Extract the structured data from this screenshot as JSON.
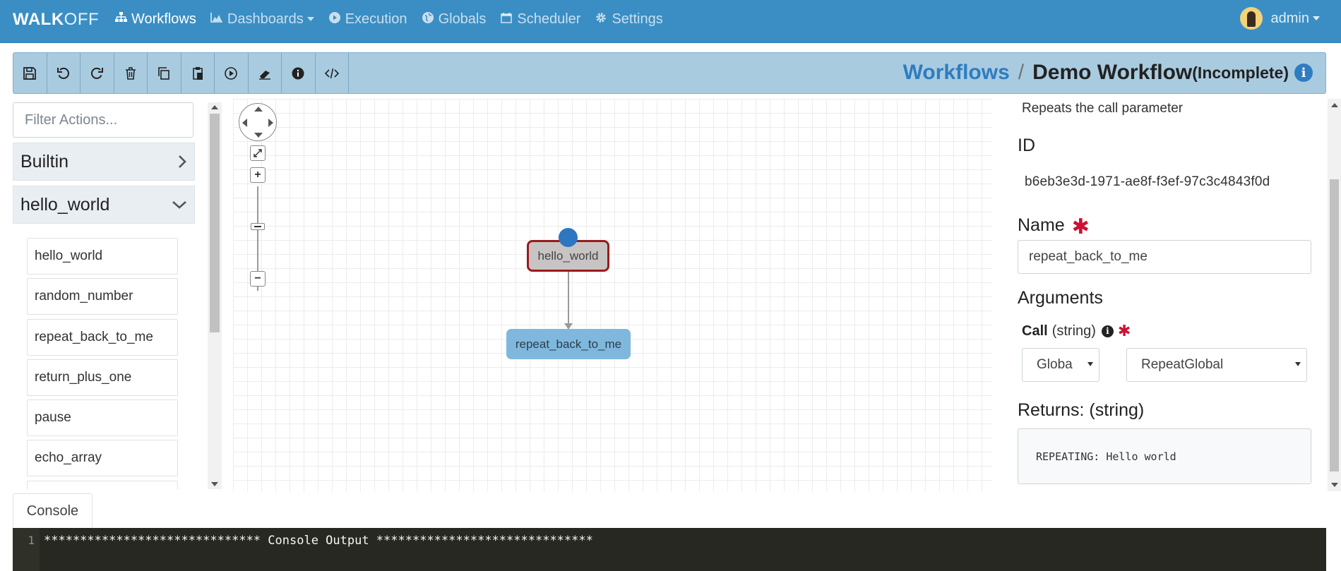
{
  "navbar": {
    "brand_bold": "WALK",
    "brand_light": "OFF",
    "items": [
      {
        "label": "Workflows",
        "icon": "sitemap-icon"
      },
      {
        "label": "Dashboards",
        "icon": "area-chart-icon"
      },
      {
        "label": "Execution",
        "icon": "play-circle-icon"
      },
      {
        "label": "Globals",
        "icon": "globe-icon"
      },
      {
        "label": "Scheduler",
        "icon": "calendar-icon"
      },
      {
        "label": "Settings",
        "icon": "gear-icon"
      }
    ],
    "user": "admin",
    "active_color": "#ffffff",
    "bar_color": "#3a8ec4"
  },
  "toolbar": {
    "buttons": [
      "save-icon",
      "undo-icon",
      "redo-icon",
      "trash-icon",
      "copy-icon",
      "paste-icon",
      "play-icon",
      "eraser-icon",
      "info-icon",
      "code-icon"
    ],
    "breadcrumb_link": "Workflows",
    "breadcrumb_sep": "/",
    "workflow_name": "Demo Workflow",
    "workflow_status": "(Incomplete)",
    "info_glyph": "i"
  },
  "palette": {
    "filter_placeholder": "Filter Actions...",
    "groups": [
      {
        "name": "Builtin",
        "expanded": false
      },
      {
        "name": "hello_world",
        "expanded": true
      }
    ],
    "actions": [
      "hello_world",
      "random_number",
      "repeat_back_to_me",
      "return_plus_one",
      "pause",
      "echo_array"
    ]
  },
  "canvas": {
    "start_node": "hello_world",
    "action_node": "repeat_back_to_me",
    "zoom_in": "+",
    "zoom_out": "−",
    "start_border_color": "#9b1b1b",
    "action_color": "#7fb8dc"
  },
  "details": {
    "description": "Repeats the call parameter",
    "id_label": "ID",
    "id_value": "b6eb3e3d-1971-ae8f-f3ef-97c3c4843f0d",
    "name_label": "Name",
    "name_value": "repeat_back_to_me",
    "arguments_label": "Arguments",
    "call_label": "Call",
    "call_type": "(string)",
    "call_info_glyph": "i",
    "required_mark": "✱",
    "source_select": "Globa",
    "value_select": "RepeatGlobal",
    "returns_label": "Returns: (string)",
    "returns_value": "REPEATING: Hello world"
  },
  "console": {
    "tab_label": "Console",
    "line_number": "1",
    "output_line": "****************************** Console Output ******************************"
  }
}
